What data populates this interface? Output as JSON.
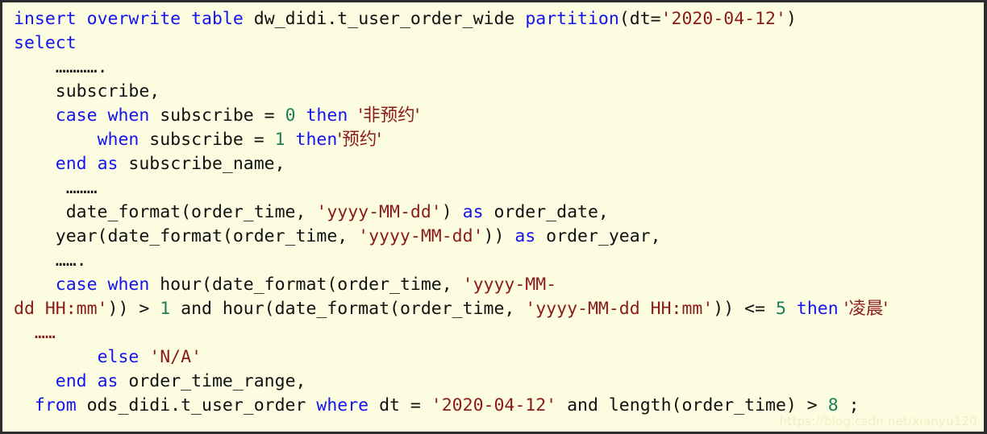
{
  "editor": {
    "background_color": "#fcfce0",
    "border_color": "#2c2c2c",
    "keyword_color": "#1414f0",
    "string_color": "#8b1a1a",
    "number_color": "#1a7f5a",
    "text_color": "#111111",
    "language": "sql"
  },
  "watermark": {
    "text": "https://blog.csdn.net/xianyu120",
    "color": "#f0efc4"
  },
  "code": {
    "full_text": "insert overwrite table dw_didi.t_user_order_wide partition(dt='2020-04-12')\nselect\n    …………\n    subscribe,\n    case when subscribe = 0 then '非预约'\n        when subscribe = 1 then'预约'\n    end as subscribe_name,\n     ………\n     date_format(order_time, 'yyyy-MM-dd') as order_date,\n    year(date_format(order_time, 'yyyy-MM-dd')) as order_year,\n    …….\n    case when hour(date_format(order_time, 'yyyy-MM-dd HH:mm')) > 1 and hour(date_format(order_time, 'yyyy-MM-dd HH:mm')) <= 5 then '凌晨'\n  ……\n        else 'N/A'\n    end as order_time_range,\n  from ods_didi.t_user_order where dt = '2020-04-12' and length(order_time) > 8 ;",
    "lines": [
      {
        "id": "line-1",
        "tokens": [
          {
            "t": "insert",
            "c": "kw"
          },
          {
            "t": " ",
            "c": "plain"
          },
          {
            "t": "overwrite",
            "c": "kw"
          },
          {
            "t": " ",
            "c": "plain"
          },
          {
            "t": "table",
            "c": "kw"
          },
          {
            "t": " dw_didi.t_user_order_wide ",
            "c": "plain"
          },
          {
            "t": "partition",
            "c": "kw"
          },
          {
            "t": "(dt=",
            "c": "plain"
          },
          {
            "t": "'2020-04-12'",
            "c": "str"
          },
          {
            "t": ")",
            "c": "plain"
          }
        ]
      },
      {
        "id": "line-2",
        "tokens": [
          {
            "t": "select",
            "c": "kw"
          }
        ]
      },
      {
        "id": "line-3",
        "tokens": [
          {
            "t": "    ",
            "c": "plain"
          },
          {
            "t": "…………",
            "c": "dots"
          },
          {
            "t": ".",
            "c": "dots"
          }
        ]
      },
      {
        "id": "line-4",
        "tokens": [
          {
            "t": "    subscribe,",
            "c": "plain"
          }
        ]
      },
      {
        "id": "line-5",
        "tokens": [
          {
            "t": "    ",
            "c": "plain"
          },
          {
            "t": "case",
            "c": "kw"
          },
          {
            "t": " ",
            "c": "plain"
          },
          {
            "t": "when",
            "c": "kw"
          },
          {
            "t": " subscribe = ",
            "c": "plain"
          },
          {
            "t": "0",
            "c": "num"
          },
          {
            "t": " ",
            "c": "plain"
          },
          {
            "t": "then",
            "c": "kw"
          },
          {
            "t": " ",
            "c": "plain"
          },
          {
            "t": "'非预约'",
            "c": "str"
          }
        ]
      },
      {
        "id": "line-6",
        "tokens": [
          {
            "t": "        ",
            "c": "plain"
          },
          {
            "t": "when",
            "c": "kw"
          },
          {
            "t": " subscribe = ",
            "c": "plain"
          },
          {
            "t": "1",
            "c": "num"
          },
          {
            "t": " ",
            "c": "plain"
          },
          {
            "t": "then",
            "c": "kw"
          },
          {
            "t": "'预约'",
            "c": "str"
          }
        ]
      },
      {
        "id": "line-7",
        "tokens": [
          {
            "t": "    ",
            "c": "plain"
          },
          {
            "t": "end",
            "c": "kw"
          },
          {
            "t": " ",
            "c": "plain"
          },
          {
            "t": "as",
            "c": "kw"
          },
          {
            "t": " subscribe_name,",
            "c": "plain"
          }
        ]
      },
      {
        "id": "line-8",
        "tokens": [
          {
            "t": "     ",
            "c": "plain"
          },
          {
            "t": "………",
            "c": "dots"
          }
        ]
      },
      {
        "id": "line-9",
        "tokens": [
          {
            "t": "     date_format(order_time, ",
            "c": "plain"
          },
          {
            "t": "'yyyy-MM-dd'",
            "c": "str"
          },
          {
            "t": ") ",
            "c": "plain"
          },
          {
            "t": "as",
            "c": "kw"
          },
          {
            "t": " order_date,",
            "c": "plain"
          }
        ]
      },
      {
        "id": "line-10",
        "tokens": [
          {
            "t": "    year(date_format(order_time, ",
            "c": "plain"
          },
          {
            "t": "'yyyy-MM-dd'",
            "c": "str"
          },
          {
            "t": ")) ",
            "c": "plain"
          },
          {
            "t": "as",
            "c": "kw"
          },
          {
            "t": " order_year,",
            "c": "plain"
          }
        ]
      },
      {
        "id": "line-11",
        "tokens": [
          {
            "t": "    ",
            "c": "plain"
          },
          {
            "t": "…….",
            "c": "dots"
          }
        ]
      },
      {
        "id": "line-12",
        "tokens": [
          {
            "t": "    ",
            "c": "plain"
          },
          {
            "t": "case",
            "c": "kw"
          },
          {
            "t": " ",
            "c": "plain"
          },
          {
            "t": "when",
            "c": "kw"
          },
          {
            "t": " hour(date_format(order_time, ",
            "c": "plain"
          },
          {
            "t": "'yyyy-MM-",
            "c": "str"
          }
        ]
      },
      {
        "id": "line-13",
        "tokens": [
          {
            "t": "dd HH:mm'",
            "c": "str"
          },
          {
            "t": ")) > ",
            "c": "plain"
          },
          {
            "t": "1",
            "c": "num"
          },
          {
            "t": " and hour(date_format(order_time, ",
            "c": "plain"
          },
          {
            "t": "'yyyy-MM-dd HH:mm'",
            "c": "str"
          },
          {
            "t": ")) <= ",
            "c": "plain"
          },
          {
            "t": "5",
            "c": "num"
          },
          {
            "t": " ",
            "c": "plain"
          },
          {
            "t": "then",
            "c": "kw"
          },
          {
            "t": " '凌晨'",
            "c": "str"
          }
        ]
      },
      {
        "id": "line-14",
        "tokens": [
          {
            "t": "  ",
            "c": "plain"
          },
          {
            "t": "……",
            "c": "dots-red"
          }
        ]
      },
      {
        "id": "line-15",
        "tokens": [
          {
            "t": "        ",
            "c": "plain"
          },
          {
            "t": "else",
            "c": "kw"
          },
          {
            "t": " ",
            "c": "plain"
          },
          {
            "t": "'N/A'",
            "c": "str"
          }
        ]
      },
      {
        "id": "line-16",
        "tokens": [
          {
            "t": "    ",
            "c": "plain"
          },
          {
            "t": "end",
            "c": "kw"
          },
          {
            "t": " ",
            "c": "plain"
          },
          {
            "t": "as",
            "c": "kw"
          },
          {
            "t": " order_time_range,",
            "c": "plain"
          }
        ]
      },
      {
        "id": "line-17",
        "tokens": [
          {
            "t": "  ",
            "c": "plain"
          },
          {
            "t": "from",
            "c": "kw"
          },
          {
            "t": " ods_didi.t_user_order ",
            "c": "plain"
          },
          {
            "t": "where",
            "c": "kw"
          },
          {
            "t": " dt = ",
            "c": "plain"
          },
          {
            "t": "'2020-04-12'",
            "c": "str"
          },
          {
            "t": " and length(order_time) > ",
            "c": "plain"
          },
          {
            "t": "8",
            "c": "num"
          },
          {
            "t": " ;",
            "c": "plain"
          }
        ]
      }
    ]
  }
}
